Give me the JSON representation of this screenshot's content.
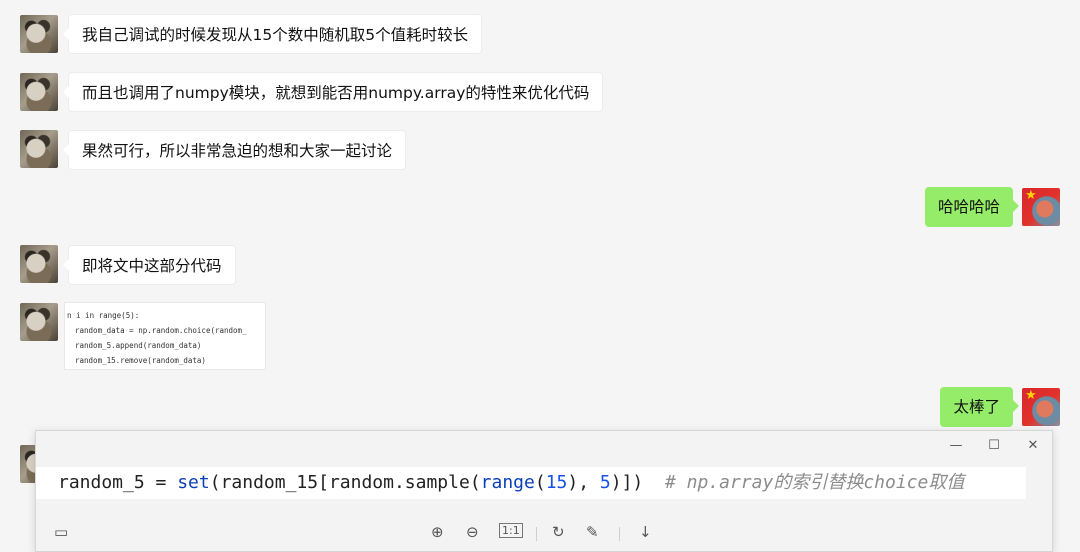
{
  "messages": [
    {
      "side": "left",
      "text": "我自己调试的时候发现从15个数中随机取5个值耗时较长"
    },
    {
      "side": "left",
      "text": "而且也调用了numpy模块，就想到能否用numpy.array的特性来优化代码"
    },
    {
      "side": "left",
      "text": "果然可行，所以非常急迫的想和大家一起讨论"
    },
    {
      "side": "right",
      "text": "哈哈哈哈"
    },
    {
      "side": "left",
      "text": "即将文中这部分代码"
    },
    {
      "side": "right",
      "text": "太棒了"
    }
  ],
  "code_thumbnail": {
    "lines": [
      "n i in range(5):",
      "random_data = np.random.choice(random_",
      "random_5.append(random_data)",
      "random_15.remove(random_data)"
    ]
  },
  "viewer": {
    "window_controls": {
      "minimize": "—",
      "maximize": "☐",
      "close": "✕"
    },
    "code": {
      "lhs": "random_5 = ",
      "fn_set": "set",
      "p1": "(random_15[random.sample(",
      "fn_range": "range",
      "p2": "(",
      "n15": "15",
      "p3": "), ",
      "n5": "5",
      "p4": ")])",
      "comment": "# np.array的索引替换choice取值"
    },
    "toolbar": {
      "zoom_in": "⊕",
      "zoom_out": "⊖",
      "actual_size": "1:1",
      "rotate": "↻",
      "edit": "✎",
      "download": "↓",
      "copy": "▭"
    }
  }
}
